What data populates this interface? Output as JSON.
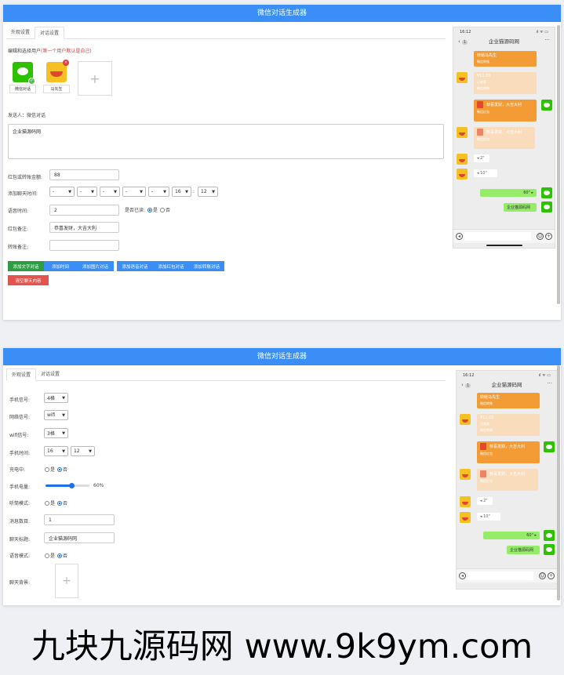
{
  "app_title": "微信对话生成器",
  "tabs": [
    "外观设置",
    "对话设置"
  ],
  "dialog": {
    "user_section_label": "编辑和选择用户",
    "user_section_hint": "(第一个用户默认是自己)",
    "users": [
      {
        "name": "微信对话"
      },
      {
        "name": "马先生"
      }
    ],
    "add_glyph": "+",
    "sender_label": "发送人：微信对话",
    "message_text": "企业猫源码网",
    "amount_label": "红包或转账金额:",
    "amount_value": "88",
    "chat_time_label": "添加聊天时间:",
    "time_selects": [
      "-",
      "-",
      "-",
      "-",
      "-",
      "16",
      "12"
    ],
    "voice_time_label": "语音时间:",
    "voice_time_value": "2",
    "read_label": "是否已读:",
    "yes": "是",
    "no": "否",
    "redpack_note_label": "红包备注:",
    "redpack_note_value": "恭喜发财，大吉大利",
    "transfer_note_label": "转账备注:",
    "transfer_note_value": "",
    "buttons": [
      "添加文字对话",
      "添加时间",
      "添加图片对话",
      "添加语音对话",
      "添加红包对话",
      "添加转账对话"
    ],
    "clear_button": "清空聊天内容",
    "colors": {
      "primary": "#3a8ef6",
      "green": "#2e9e44",
      "danger": "#e4544f"
    }
  },
  "appearance": {
    "signal_label": "手机信号:",
    "signal_value": "4格",
    "network_label": "网络信号:",
    "network_value": "wifi",
    "wifi_label": "wifi信号:",
    "wifi_value": "3格",
    "time_label": "手机时间:",
    "time_hour": "16",
    "time_minute": "12",
    "charging_label": "充电中:",
    "battery_label": "手机电量:",
    "battery_value": "60%",
    "battery_fraction": 0.6,
    "earpiece_label": "听筒模式:",
    "unread_label": "消息数目:",
    "unread_value": "1",
    "chat_title_label": "聊天标题:",
    "chat_title_value": "企业猫源码网",
    "voice_mode_label": "语音模式:",
    "background_label": "聊天背景:",
    "yes": "是",
    "no": "否"
  },
  "phone": {
    "time": "16:12",
    "signal_glyph": "ıl ᯤ ▭",
    "title": "企业猫源码网",
    "badge": "1",
    "back_glyph": "‹",
    "more_glyph": "···",
    "messages": {
      "m1_text": "转给马先生",
      "m1_foot": "微信转账",
      "m2_text": "¥11.00",
      "m2_sub": "已收款",
      "m2_foot": "微信转账",
      "m3_text": "恭喜发财，大吉大利",
      "m3_foot": "微信红包",
      "m4_text": "恭喜发财，大吉大利",
      "m4_foot": "微信红包",
      "v1": "2\"",
      "v2": "10\"",
      "v3": "60\"",
      "t1": "企业猫源码网"
    }
  },
  "watermark": "九块九源码网 www.9k9ym.com"
}
